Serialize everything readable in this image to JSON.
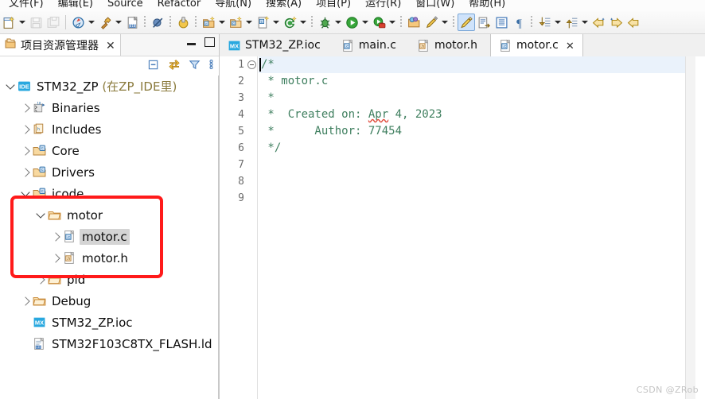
{
  "menubar": {
    "items": [
      {
        "label": "文件(F)",
        "name": "menu-file"
      },
      {
        "label": "编辑(E)",
        "name": "menu-edit"
      },
      {
        "label": "Source",
        "name": "menu-source"
      },
      {
        "label": "Refactor",
        "name": "menu-refactor"
      },
      {
        "label": "导航(N)",
        "name": "menu-navigate"
      },
      {
        "label": "搜索(A)",
        "name": "menu-search"
      },
      {
        "label": "项目(P)",
        "name": "menu-project"
      },
      {
        "label": "运行(R)",
        "name": "menu-run"
      },
      {
        "label": "窗口(W)",
        "name": "menu-window"
      },
      {
        "label": "帮助(H)",
        "name": "menu-help"
      }
    ]
  },
  "toolbar": {
    "groups": [
      {
        "items": [
          {
            "icon": "new-file-icon",
            "kind": "icon",
            "enabled": true
          },
          {
            "icon": "chevron-down-icon",
            "kind": "arrow"
          },
          {
            "icon": "save-icon",
            "kind": "icon",
            "enabled": false
          },
          {
            "icon": "save-all-icon",
            "kind": "icon",
            "enabled": false
          }
        ]
      },
      {
        "sep": "line",
        "items": [
          {
            "icon": "build-config-icon",
            "kind": "icon",
            "enabled": true
          },
          {
            "icon": "chevron-down-icon",
            "kind": "arrow"
          },
          {
            "icon": "build-hammer-icon",
            "kind": "icon",
            "enabled": true
          },
          {
            "icon": "chevron-down-icon",
            "kind": "arrow"
          },
          {
            "icon": "binary-file-icon",
            "kind": "icon",
            "enabled": true
          }
        ]
      },
      {
        "sep": "dots",
        "items": [
          {
            "icon": "skip-breakpoints-icon",
            "kind": "icon",
            "enabled": true
          }
        ]
      },
      {
        "sep": "dots",
        "items": [
          {
            "icon": "build-all-icon",
            "kind": "icon",
            "enabled": true
          }
        ]
      },
      {
        "sep": "dots",
        "items": [
          {
            "icon": "new-c-project-icon",
            "kind": "icon",
            "enabled": true
          },
          {
            "icon": "chevron-down-icon",
            "kind": "arrow"
          },
          {
            "icon": "new-c-folder-icon",
            "kind": "icon",
            "enabled": true
          },
          {
            "icon": "chevron-down-icon",
            "kind": "arrow"
          },
          {
            "icon": "new-c-file-icon",
            "kind": "icon",
            "enabled": true
          },
          {
            "icon": "chevron-down-icon",
            "kind": "arrow"
          },
          {
            "icon": "new-class-icon",
            "kind": "icon",
            "enabled": true
          },
          {
            "icon": "chevron-down-icon",
            "kind": "arrow"
          }
        ]
      },
      {
        "sep": "dots",
        "items": [
          {
            "icon": "debug-icon",
            "kind": "icon",
            "enabled": true
          },
          {
            "icon": "chevron-down-icon",
            "kind": "arrow"
          },
          {
            "icon": "run-icon",
            "kind": "icon",
            "enabled": true
          },
          {
            "icon": "chevron-down-icon",
            "kind": "arrow"
          },
          {
            "icon": "run-external-tools-icon",
            "kind": "icon",
            "enabled": true
          },
          {
            "icon": "chevron-down-icon",
            "kind": "arrow"
          }
        ]
      },
      {
        "sep": "dots",
        "items": [
          {
            "icon": "open-resource-icon",
            "kind": "icon",
            "enabled": true
          },
          {
            "icon": "search-pencil-icon",
            "kind": "icon",
            "enabled": true
          },
          {
            "icon": "chevron-down-icon",
            "kind": "arrow"
          }
        ]
      },
      {
        "sep": "dots",
        "items": [
          {
            "icon": "toggle-markers-icon",
            "kind": "icon",
            "enabled": true,
            "pressed": true
          },
          {
            "icon": "toggle-block-selection-icon",
            "kind": "icon",
            "enabled": true
          },
          {
            "icon": "show-whitespace-icon",
            "kind": "icon",
            "enabled": true
          },
          {
            "icon": "pilcrow-icon",
            "kind": "icon",
            "enabled": true
          }
        ]
      },
      {
        "sep": "dots",
        "items": [
          {
            "icon": "next-annotation-icon",
            "kind": "icon",
            "enabled": true
          },
          {
            "icon": "chevron-down-icon",
            "kind": "arrow"
          },
          {
            "icon": "prev-annotation-icon",
            "kind": "icon",
            "enabled": true
          },
          {
            "icon": "chevron-down-icon",
            "kind": "arrow"
          },
          {
            "icon": "back-history-icon",
            "kind": "icon",
            "enabled": true
          },
          {
            "icon": "forward-history-icon",
            "kind": "icon",
            "enabled": true
          },
          {
            "icon": "back-arrow-icon",
            "kind": "icon",
            "enabled": true
          }
        ]
      }
    ]
  },
  "left_panel": {
    "tab_label": "项目资源管理器",
    "tab_close": "✕",
    "view_toolbar": [
      {
        "name": "collapse-all-icon"
      },
      {
        "name": "link-with-editor-icon"
      },
      {
        "name": "filter-icon"
      },
      {
        "name": "view-menu-icon"
      }
    ],
    "window_buttons": [
      {
        "name": "minimize-button"
      },
      {
        "name": "maximize-button"
      }
    ],
    "tree": [
      {
        "label": "STM32_ZP ",
        "suffix": "(在ZP_IDE里)",
        "indent": 0,
        "twisty": "down",
        "icon": "ide-project-icon",
        "selected": false
      },
      {
        "label": "Binaries",
        "indent": 1,
        "twisty": "right",
        "icon": "binaries-icon",
        "selected": false
      },
      {
        "label": "Includes",
        "indent": 1,
        "twisty": "right",
        "icon": "includes-icon",
        "selected": false
      },
      {
        "label": "Core",
        "indent": 1,
        "twisty": "right",
        "icon": "source-folder-icon",
        "selected": false
      },
      {
        "label": "Drivers",
        "indent": 1,
        "twisty": "right",
        "icon": "source-folder-icon",
        "selected": false
      },
      {
        "label": "icode",
        "indent": 1,
        "twisty": "down",
        "icon": "source-folder-icon",
        "selected": false
      },
      {
        "label": "motor",
        "indent": 2,
        "twisty": "down",
        "icon": "folder-icon",
        "selected": false
      },
      {
        "label": "motor.c",
        "indent": 3,
        "twisty": "right",
        "icon": "c-file-icon",
        "selected": true
      },
      {
        "label": "motor.h",
        "indent": 3,
        "twisty": "right",
        "icon": "h-file-icon",
        "selected": false
      },
      {
        "label": "pid",
        "indent": 2,
        "twisty": "right",
        "icon": "folder-icon",
        "selected": false
      },
      {
        "label": "Debug",
        "indent": 1,
        "twisty": "right",
        "icon": "folder-icon",
        "selected": false
      },
      {
        "label": "STM32_ZP.ioc",
        "indent": 1,
        "twisty": "none",
        "icon": "mx-ioc-icon",
        "selected": false
      },
      {
        "label": "STM32F103C8TX_FLASH.ld",
        "indent": 1,
        "twisty": "none",
        "icon": "ld-file-icon",
        "selected": false
      }
    ]
  },
  "editor": {
    "tabs": [
      {
        "label": "STM32_ZP.ioc",
        "icon": "mx-ioc-icon",
        "active": false,
        "closable": false
      },
      {
        "label": "main.c",
        "icon": "c-file-icon",
        "active": false,
        "closable": false
      },
      {
        "label": "motor.h",
        "icon": "h-file-icon",
        "active": false,
        "closable": false
      },
      {
        "label": "motor.c",
        "icon": "c-file-icon",
        "active": true,
        "closable": true,
        "close": "✕"
      }
    ],
    "line_numbers": [
      "1",
      "2",
      "3",
      "4",
      "5",
      "6",
      "7",
      "8",
      "9"
    ],
    "lines": [
      {
        "text": "/*",
        "current": true,
        "fold": true
      },
      {
        "text": " * motor.c",
        "current": false,
        "fold": false
      },
      {
        "text": " *",
        "current": false,
        "fold": false
      },
      {
        "text": " *  Created on: Apr 4, 2023",
        "current": false,
        "fold": false,
        "spell_word": "Apr"
      },
      {
        "text": " *      Author: 77454",
        "current": false,
        "fold": false
      },
      {
        "text": " */",
        "current": false,
        "fold": false
      },
      {
        "text": "",
        "current": false,
        "fold": false
      },
      {
        "text": "",
        "current": false,
        "fold": false
      },
      {
        "text": "",
        "current": false,
        "fold": false
      }
    ],
    "comment_color": "#3f7f5f"
  },
  "watermark": "CSDN @ZRob",
  "colors": {
    "accent_red": "#ff1a1a",
    "selection_gray": "#d4d4d4",
    "current_line": "#eaf2fb",
    "comment_green": "#3f7f5f",
    "project_suffix": "#8a7a3c"
  }
}
